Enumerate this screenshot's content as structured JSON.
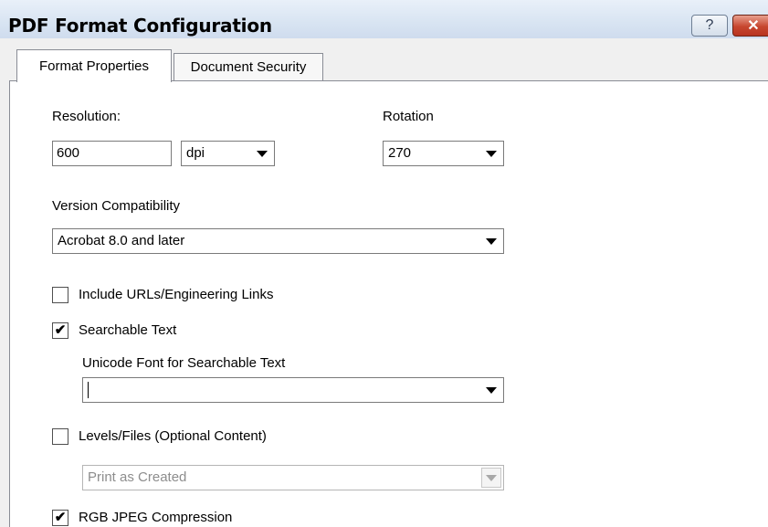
{
  "window": {
    "title": "PDF Format Configuration",
    "help_label": "?",
    "close_label": "✕"
  },
  "tabs": [
    {
      "label": "Format Properties",
      "active": true
    },
    {
      "label": "Document Security",
      "active": false
    }
  ],
  "resolution": {
    "label": "Resolution:",
    "value": "600",
    "unit": "dpi"
  },
  "rotation": {
    "label": "Rotation",
    "value": "270"
  },
  "version": {
    "label": "Version Compatibility",
    "value": "Acrobat 8.0 and later"
  },
  "include_urls": {
    "label": "Include URLs/Engineering Links",
    "checked": false
  },
  "searchable_text": {
    "label": "Searchable Text",
    "checked": true,
    "mark": "✔"
  },
  "unicode_font": {
    "label": "Unicode Font for Searchable Text",
    "value": ""
  },
  "levels_files": {
    "label": "Levels/Files (Optional Content)",
    "checked": false
  },
  "print_mode": {
    "value": "Print as Created",
    "enabled": false
  },
  "rgb_jpeg": {
    "label": "RGB JPEG Compression",
    "checked": true,
    "mark": "✔"
  }
}
